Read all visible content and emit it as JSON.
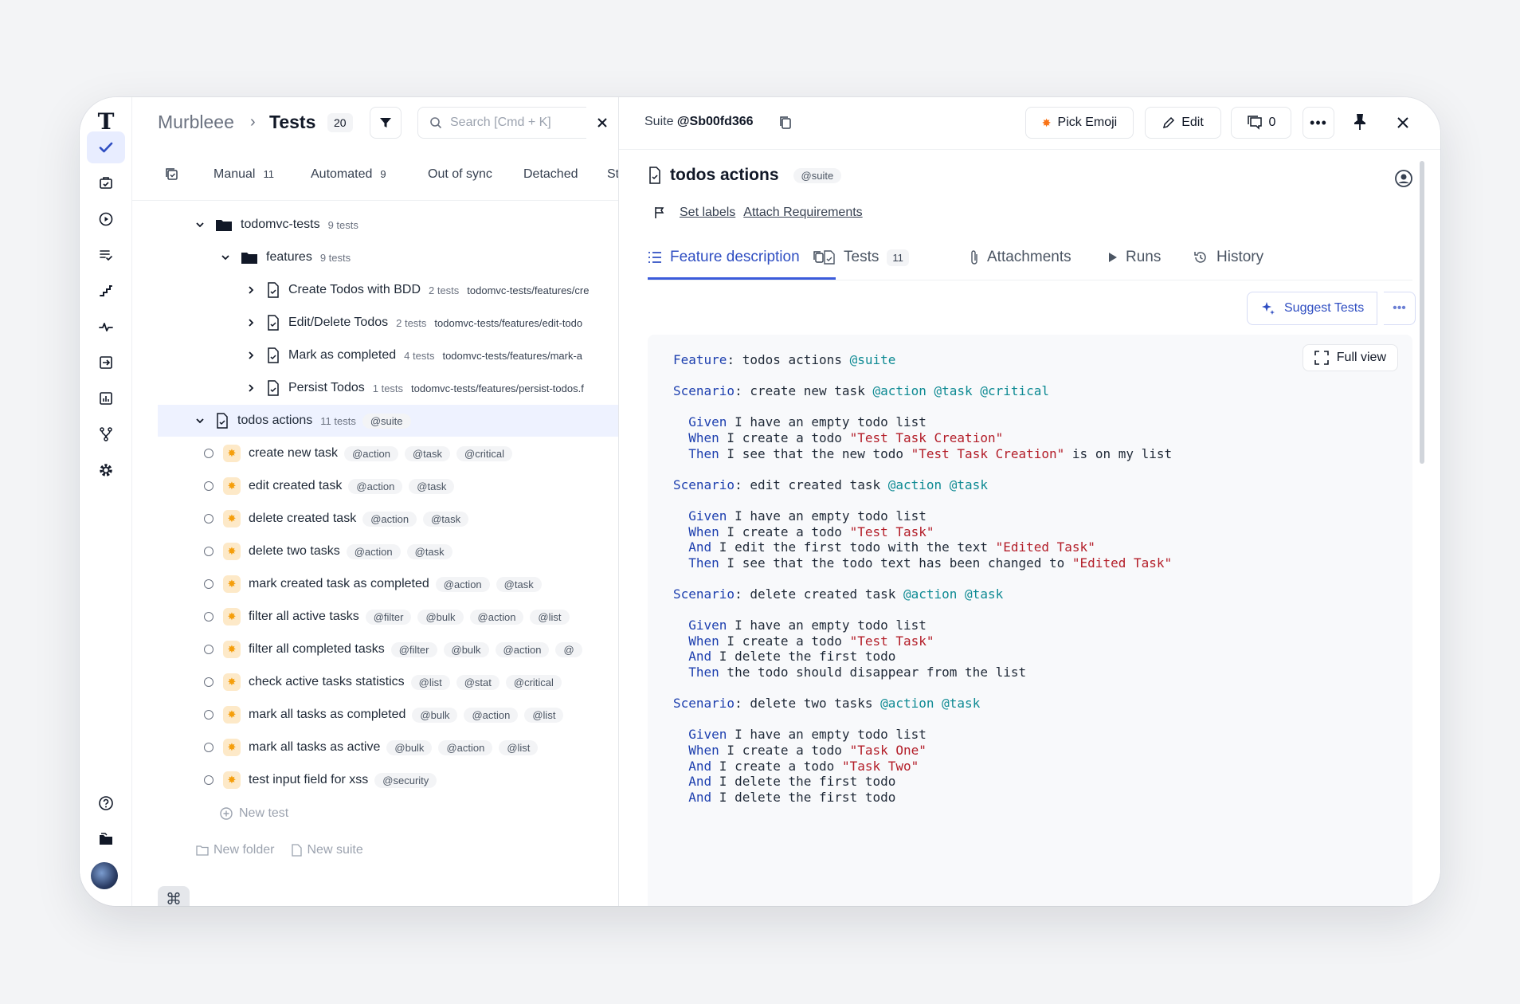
{
  "rail": {
    "logo": "T",
    "items": [
      "tests-icon",
      "plans-icon",
      "runs-icon",
      "checklist-icon",
      "steps-icon",
      "pulse-icon",
      "import-icon",
      "analytics-icon",
      "branches-icon",
      "settings-icon"
    ],
    "bottom": [
      "help-icon",
      "docs-icon"
    ]
  },
  "header": {
    "project": "Murbleee",
    "separator": "›",
    "title": "Tests",
    "count": "20",
    "search_placeholder": "Search [Cmd + K]"
  },
  "tabs": [
    {
      "label": "Manual",
      "count": "11"
    },
    {
      "label": "Automated",
      "count": "9"
    },
    {
      "label": "Out of sync",
      "count": ""
    },
    {
      "label": "Detached",
      "count": ""
    },
    {
      "label": "St",
      "count": ""
    }
  ],
  "tree": {
    "root_folder": {
      "name": "todomvc-tests",
      "meta": "9 tests"
    },
    "sub_folder": {
      "name": "features",
      "meta": "9 tests"
    },
    "suites": [
      {
        "name": "Create Todos with BDD",
        "meta": "2 tests",
        "path": "todomvc-tests/features/cre"
      },
      {
        "name": "Edit/Delete Todos",
        "meta": "2 tests",
        "path": "todomvc-tests/features/edit-todo"
      },
      {
        "name": "Mark as completed",
        "meta": "4 tests",
        "path": "todomvc-tests/features/mark-a"
      },
      {
        "name": "Persist Todos",
        "meta": "1 tests",
        "path": "todomvc-tests/features/persist-todos.f"
      }
    ],
    "selected_suite": {
      "name": "todos actions",
      "meta": "11 tests",
      "tag": "@suite"
    },
    "tests": [
      {
        "name": "create new task",
        "tags": [
          "@action",
          "@task",
          "@critical"
        ]
      },
      {
        "name": "edit created task",
        "tags": [
          "@action",
          "@task"
        ]
      },
      {
        "name": "delete created task",
        "tags": [
          "@action",
          "@task"
        ]
      },
      {
        "name": "delete two tasks",
        "tags": [
          "@action",
          "@task"
        ]
      },
      {
        "name": "mark created task as completed",
        "tags": [
          "@action",
          "@task"
        ]
      },
      {
        "name": "filter all active tasks",
        "tags": [
          "@filter",
          "@bulk",
          "@action",
          "@list"
        ]
      },
      {
        "name": "filter all completed tasks",
        "tags": [
          "@filter",
          "@bulk",
          "@action",
          "@"
        ]
      },
      {
        "name": "check active tasks statistics",
        "tags": [
          "@list",
          "@stat",
          "@critical"
        ]
      },
      {
        "name": "mark all tasks as completed",
        "tags": [
          "@bulk",
          "@action",
          "@list"
        ]
      },
      {
        "name": "mark all tasks as active",
        "tags": [
          "@bulk",
          "@action",
          "@list"
        ]
      },
      {
        "name": "test input field for xss",
        "tags": [
          "@security"
        ]
      }
    ],
    "new_test": "New test",
    "new_folder": "New folder",
    "new_suite": "New suite"
  },
  "panel": {
    "suite_label": "Suite",
    "suite_id": "@Sb00fd366",
    "pick_emoji": "Pick Emoji",
    "edit": "Edit",
    "comments": "0",
    "title": "todos actions",
    "title_tag": "@suite",
    "set_labels": "Set labels",
    "attach_requirements": "Attach Requirements",
    "tabs": [
      {
        "label": "Feature description",
        "count": ""
      },
      {
        "label": "Tests",
        "count": "11"
      },
      {
        "label": "Attachments",
        "count": ""
      },
      {
        "label": "Runs",
        "count": ""
      },
      {
        "label": "History",
        "count": ""
      }
    ],
    "suggest_tests": "Suggest Tests",
    "full_view": "Full view"
  },
  "code_lines": [
    [
      {
        "c": "kw",
        "t": "Feature"
      },
      {
        "c": "",
        "t": ": todos actions "
      },
      {
        "c": "tg",
        "t": "@suite"
      }
    ],
    [],
    [
      {
        "c": "kw",
        "t": "Scenario"
      },
      {
        "c": "",
        "t": ": create new task "
      },
      {
        "c": "tg",
        "t": "@action @task @critical"
      }
    ],
    [],
    [
      {
        "c": "",
        "t": "  "
      },
      {
        "c": "kw",
        "t": "Given"
      },
      {
        "c": "",
        "t": " I have an empty todo list"
      }
    ],
    [
      {
        "c": "",
        "t": "  "
      },
      {
        "c": "kw",
        "t": "When"
      },
      {
        "c": "",
        "t": " I create a todo "
      },
      {
        "c": "st",
        "t": "\"Test Task Creation\""
      }
    ],
    [
      {
        "c": "",
        "t": "  "
      },
      {
        "c": "kw",
        "t": "Then"
      },
      {
        "c": "",
        "t": " I see that the new todo "
      },
      {
        "c": "st",
        "t": "\"Test Task Creation\""
      },
      {
        "c": "",
        "t": " is on my list"
      }
    ],
    [],
    [
      {
        "c": "kw",
        "t": "Scenario"
      },
      {
        "c": "",
        "t": ": edit created task "
      },
      {
        "c": "tg",
        "t": "@action @task"
      }
    ],
    [],
    [
      {
        "c": "",
        "t": "  "
      },
      {
        "c": "kw",
        "t": "Given"
      },
      {
        "c": "",
        "t": " I have an empty todo list"
      }
    ],
    [
      {
        "c": "",
        "t": "  "
      },
      {
        "c": "kw",
        "t": "When"
      },
      {
        "c": "",
        "t": " I create a todo "
      },
      {
        "c": "st",
        "t": "\"Test Task\""
      }
    ],
    [
      {
        "c": "",
        "t": "  "
      },
      {
        "c": "kw",
        "t": "And"
      },
      {
        "c": "",
        "t": " I edit the first todo with the text "
      },
      {
        "c": "st",
        "t": "\"Edited Task\""
      }
    ],
    [
      {
        "c": "",
        "t": "  "
      },
      {
        "c": "kw",
        "t": "Then"
      },
      {
        "c": "",
        "t": " I see that the todo text has been changed to "
      },
      {
        "c": "st",
        "t": "\"Edited Task\""
      }
    ],
    [],
    [
      {
        "c": "kw",
        "t": "Scenario"
      },
      {
        "c": "",
        "t": ": delete created task "
      },
      {
        "c": "tg",
        "t": "@action @task"
      }
    ],
    [],
    [
      {
        "c": "",
        "t": "  "
      },
      {
        "c": "kw",
        "t": "Given"
      },
      {
        "c": "",
        "t": " I have an empty todo list"
      }
    ],
    [
      {
        "c": "",
        "t": "  "
      },
      {
        "c": "kw",
        "t": "When"
      },
      {
        "c": "",
        "t": " I create a todo "
      },
      {
        "c": "st",
        "t": "\"Test Task\""
      }
    ],
    [
      {
        "c": "",
        "t": "  "
      },
      {
        "c": "kw",
        "t": "And"
      },
      {
        "c": "",
        "t": " I delete the first todo"
      }
    ],
    [
      {
        "c": "",
        "t": "  "
      },
      {
        "c": "kw",
        "t": "Then"
      },
      {
        "c": "",
        "t": " the todo should disappear from the list"
      }
    ],
    [],
    [
      {
        "c": "kw",
        "t": "Scenario"
      },
      {
        "c": "",
        "t": ": delete two tasks "
      },
      {
        "c": "tg",
        "t": "@action @task"
      }
    ],
    [],
    [
      {
        "c": "",
        "t": "  "
      },
      {
        "c": "kw",
        "t": "Given"
      },
      {
        "c": "",
        "t": " I have an empty todo list"
      }
    ],
    [
      {
        "c": "",
        "t": "  "
      },
      {
        "c": "kw",
        "t": "When"
      },
      {
        "c": "",
        "t": " I create a todo "
      },
      {
        "c": "st",
        "t": "\"Task One\""
      }
    ],
    [
      {
        "c": "",
        "t": "  "
      },
      {
        "c": "kw",
        "t": "And"
      },
      {
        "c": "",
        "t": " I create a todo "
      },
      {
        "c": "st",
        "t": "\"Task Two\""
      }
    ],
    [
      {
        "c": "",
        "t": "  "
      },
      {
        "c": "kw",
        "t": "And"
      },
      {
        "c": "",
        "t": " I delete the first todo"
      }
    ],
    [
      {
        "c": "",
        "t": "  "
      },
      {
        "c": "kw",
        "t": "And"
      },
      {
        "c": "",
        "t": " I delete the first todo"
      }
    ]
  ],
  "colors": {
    "accent": "#3b5bdb",
    "tag_teal": "#0e8a93",
    "string_red": "#b31d28",
    "selected_row": "#eef2ff"
  }
}
